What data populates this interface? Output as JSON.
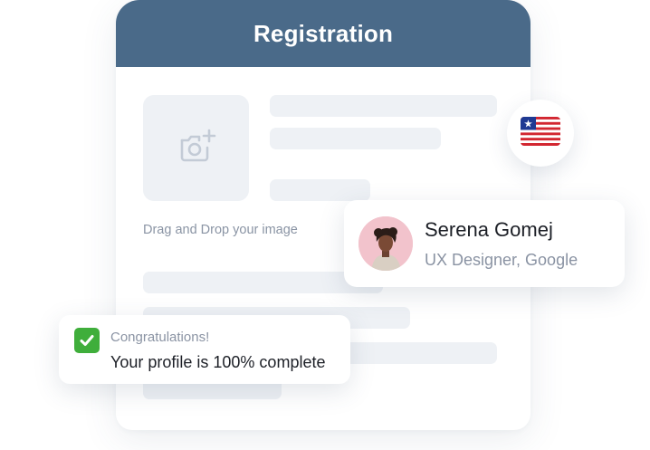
{
  "registration": {
    "title": "Registration",
    "drag_text": "Drag and Drop your image",
    "upload_icon": "camera-plus-icon"
  },
  "flag": {
    "icon": "liberia-flag-icon"
  },
  "profile": {
    "name": "Serena Gomej",
    "role": "UX Designer, Google"
  },
  "congrats": {
    "title": "Congratulations!",
    "message": "Your profile is 100% complete",
    "icon": "check-mark-icon"
  },
  "colors": {
    "header": "#4a6a89",
    "placeholder": "#eef1f5",
    "check": "#3fae3b"
  }
}
